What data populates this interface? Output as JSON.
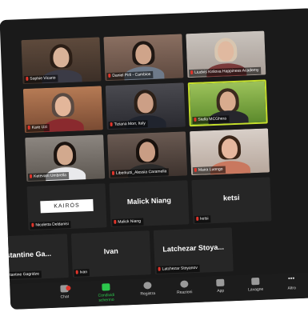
{
  "participants": [
    {
      "name": "Sophie Vicario",
      "kind": "video"
    },
    {
      "name": "Daniel Pirli - Cambios",
      "kind": "video"
    },
    {
      "name": "Liudvis Kirilova Happiness Academy",
      "kind": "video"
    },
    {
      "name": "Kare Uzi",
      "kind": "video"
    },
    {
      "name": "Tiziana Morr, Italy",
      "kind": "video"
    },
    {
      "name": "Stella MCGhera",
      "kind": "video"
    },
    {
      "name": "Ketevani Umbrella",
      "kind": "video"
    },
    {
      "name": "Liberkutti_Alessia Caramella",
      "kind": "video"
    },
    {
      "name": "Maira Luongo",
      "kind": "video"
    },
    {
      "name": "Nicoletta Deldanisi",
      "kind": "logo",
      "display": "KAIRÓS"
    },
    {
      "name": "Malick Niang",
      "kind": "name",
      "display": "Malick Niang"
    },
    {
      "name": "ketsi",
      "kind": "name",
      "display": "ketsi"
    },
    {
      "name": "stantine Gagridze",
      "kind": "name",
      "display": "stantine Ga..."
    },
    {
      "name": "Ivan",
      "kind": "name",
      "display": "Ivan"
    },
    {
      "name": "Latchezar Stoyanov",
      "kind": "name",
      "display": "Latchezar Stoya..."
    }
  ],
  "toolbar": {
    "chat": "Chat",
    "share": "Condividi schermo",
    "record": "Registra",
    "reactions": "Reazioni",
    "apps": "App",
    "whiteboards": "Lavagne",
    "more": "Altro"
  },
  "colors": {
    "share_accent": "#2cc64c",
    "muted_mic": "#e0352b"
  }
}
